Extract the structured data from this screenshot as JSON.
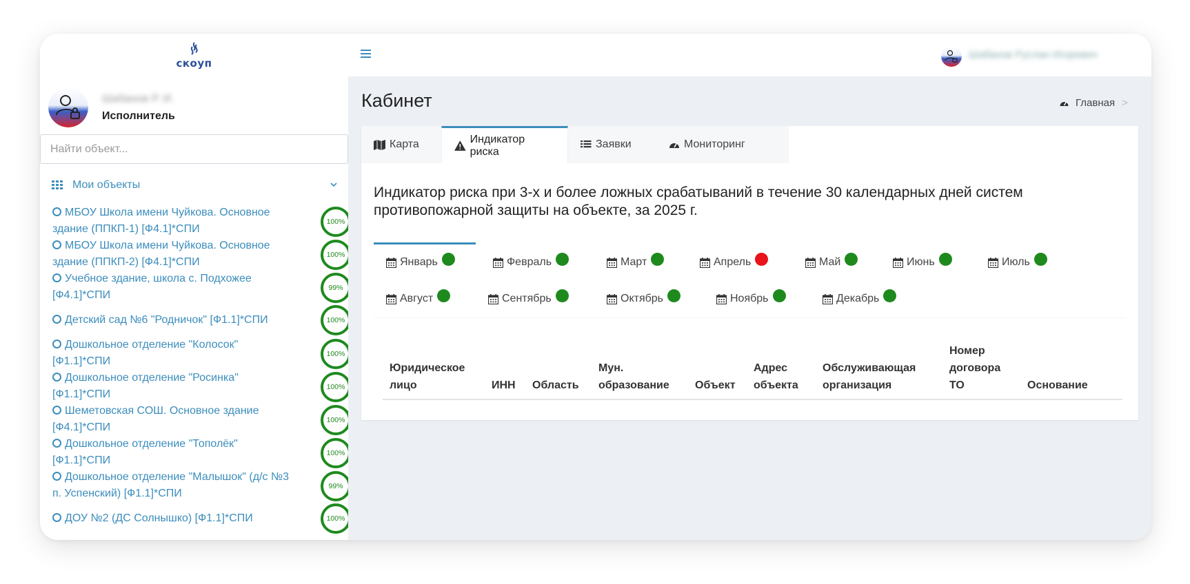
{
  "sidebar": {
    "logo_text": "скоуп",
    "user_name": "Шабанов Р. И.",
    "user_role": "Исполнитель",
    "search_placeholder": "Найти объект...",
    "menu_label": "Мои объекты",
    "objects": [
      {
        "name": "МБОУ Школа имени Чуйкова. Основное здание (ППКП-1) [Ф4.1]*СПИ",
        "percent": "100%"
      },
      {
        "name": "МБОУ Школа имени Чуйкова. Основное здание (ППКП-2) [Ф4.1]*СПИ",
        "percent": "100%"
      },
      {
        "name": "Учебное здание, школа с. Подхожее [Ф4.1]*СПИ",
        "percent": "99%"
      },
      {
        "name": "Детский сад №6 \"Родничок\" [Ф1.1]*СПИ",
        "percent": "100%"
      },
      {
        "name": "Дошкольное отделение \"Колосок\" [Ф1.1]*СПИ",
        "percent": "100%"
      },
      {
        "name": "Дошкольное отделение \"Росинка\" [Ф1.1]*СПИ",
        "percent": "100%"
      },
      {
        "name": "Шеметовская СОШ. Основное здание [Ф4.1]*СПИ",
        "percent": "100%"
      },
      {
        "name": "Дошкольное отделение \"Тополёк\" [Ф1.1]*СПИ",
        "percent": "100%"
      },
      {
        "name": "Дошкольное отделение \"Малышок\" (д/с №3 п. Успенский) [Ф1.1]*СПИ",
        "percent": "99%"
      },
      {
        "name": "ДОУ №2 (ДС Солнышко) [Ф1.1]*СПИ",
        "percent": "100%"
      }
    ]
  },
  "topbar": {
    "user_full_name": "Шабанов Руслан Игоревич"
  },
  "page": {
    "title": "Кабинет",
    "breadcrumb_home": "Главная",
    "breadcrumb_sep": ">"
  },
  "tabs": [
    {
      "label": "Карта",
      "icon": "map-icon"
    },
    {
      "label": "Индикатор риска",
      "icon": "warning-icon",
      "active": true
    },
    {
      "label": "Заявки",
      "icon": "list-icon"
    },
    {
      "label": "Мониторинг",
      "icon": "dashboard-icon"
    }
  ],
  "risk": {
    "title": "Индикатор риска при 3-х и более ложных срабатываний в течение 30 календарных дней систем противопожарной защиты на объекте, за 2025 г."
  },
  "months": [
    {
      "label": "Январь",
      "status": "green",
      "active": true
    },
    {
      "label": "Февраль",
      "status": "green"
    },
    {
      "label": "Март",
      "status": "green"
    },
    {
      "label": "Апрель",
      "status": "red"
    },
    {
      "label": "Май",
      "status": "green"
    },
    {
      "label": "Июнь",
      "status": "green"
    },
    {
      "label": "Июль",
      "status": "green"
    },
    {
      "label": "Август",
      "status": "green"
    },
    {
      "label": "Сентябрь",
      "status": "green"
    },
    {
      "label": "Октябрь",
      "status": "green"
    },
    {
      "label": "Ноябрь",
      "status": "green"
    },
    {
      "label": "Декабрь",
      "status": "green"
    }
  ],
  "table": {
    "headers": [
      "Юридическое лицо",
      "ИНН",
      "Область",
      "Мун. образование",
      "Объект",
      "Адрес объекта",
      "Обслуживающая организация",
      "Номер договора ТО",
      "Основание"
    ]
  },
  "colors": {
    "accent": "#3c8dbc",
    "ok": "#1e8a1e",
    "alert": "#e8131b",
    "background": "#ecf0f5"
  }
}
